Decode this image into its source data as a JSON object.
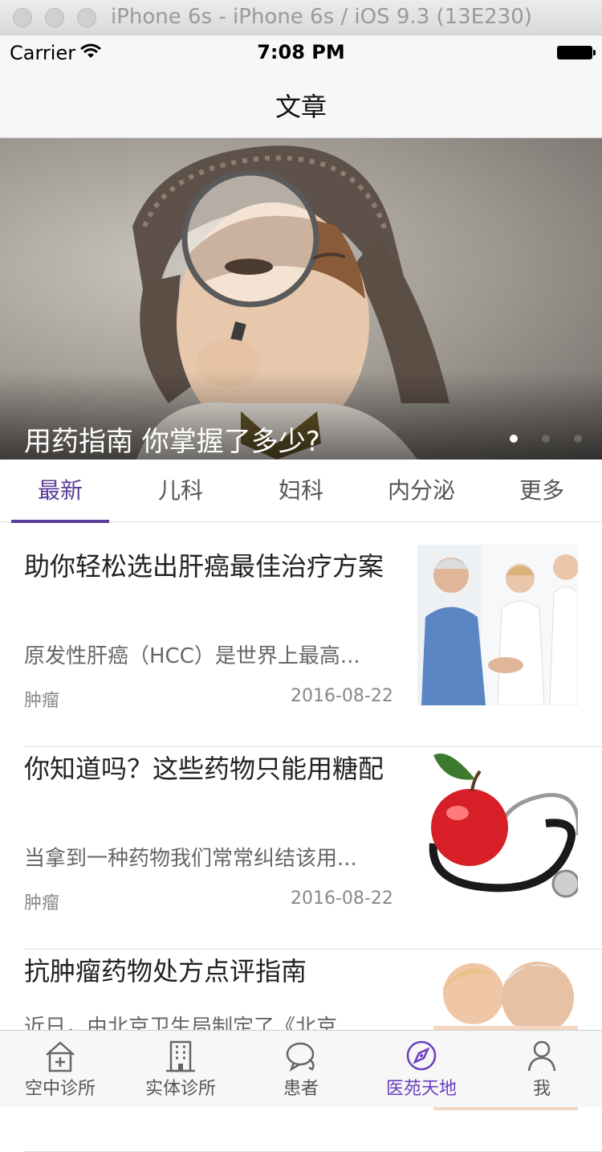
{
  "window": {
    "title": "iPhone 6s - iPhone 6s / iOS 9.3 (13E230)"
  },
  "status_bar": {
    "carrier": "Carrier",
    "time": "7:08 PM"
  },
  "nav": {
    "title": "文章"
  },
  "banner": {
    "caption": "用药指南 你掌握了多少?",
    "page_count": 3,
    "current_page": 1
  },
  "tabs": [
    {
      "label": "最新",
      "active": true
    },
    {
      "label": "儿科"
    },
    {
      "label": "妇科"
    },
    {
      "label": "内分泌"
    },
    {
      "label": "更多"
    }
  ],
  "articles": [
    {
      "title": "助你轻松选出肝癌最佳治疗方案",
      "summary": "原发性肝癌（HCC）是世界上最高...",
      "tag": "肿瘤",
      "date": "2016-08-22"
    },
    {
      "title": "你知道吗？这些药物只能用糖配",
      "summary": "当拿到一种药物我们常常纠结该用...",
      "tag": "肿瘤",
      "date": "2016-08-22"
    },
    {
      "title": "抗肿瘤药物处方点评指南",
      "summary": "近日，由北京卫生局制定了《北京",
      "tag": "",
      "date": ""
    }
  ],
  "tabbar": [
    {
      "label": "空中诊所",
      "icon": "house-plus-icon"
    },
    {
      "label": "实体诊所",
      "icon": "building-icon"
    },
    {
      "label": "患者",
      "icon": "chat-bubble-icon"
    },
    {
      "label": "医苑天地",
      "icon": "compass-icon",
      "active": true
    },
    {
      "label": "我",
      "icon": "person-icon"
    }
  ],
  "colors": {
    "accent": "#5a3e9a",
    "tab_active": "#6a3fc2"
  }
}
